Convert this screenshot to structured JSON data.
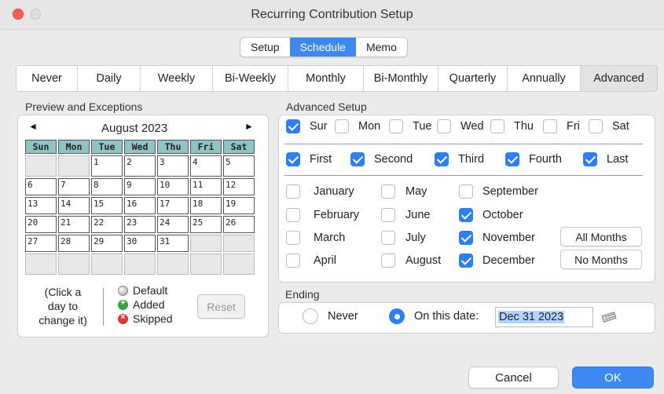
{
  "window": {
    "title": "Recurring Contribution Setup"
  },
  "top_tabs": [
    {
      "label": "Setup",
      "active": false
    },
    {
      "label": "Schedule",
      "active": true
    },
    {
      "label": "Memo",
      "active": false
    }
  ],
  "recurrence_tabs": [
    "Never",
    "Daily",
    "Weekly",
    "Bi-Weekly",
    "Monthly",
    "Bi-Monthly",
    "Quarterly",
    "Annually",
    "Advanced"
  ],
  "recurrence_selected": "Advanced",
  "preview": {
    "section_label": "Preview and Exceptions",
    "prev_icon": "◄",
    "next_icon": "►",
    "month": "August 2023",
    "weekdays": [
      "Sun",
      "Mon",
      "Tue",
      "Wed",
      "Thu",
      "Fri",
      "Sat"
    ],
    "weeks": [
      [
        "",
        "",
        "1",
        "2",
        "3",
        "4",
        "5"
      ],
      [
        "6",
        "7",
        "8",
        "9",
        "10",
        "11",
        "12"
      ],
      [
        "13",
        "14",
        "15",
        "16",
        "17",
        "18",
        "19"
      ],
      [
        "20",
        "21",
        "22",
        "23",
        "24",
        "25",
        "26"
      ],
      [
        "27",
        "28",
        "29",
        "30",
        "31",
        "",
        ""
      ],
      [
        "",
        "",
        "",
        "",
        "",
        "",
        ""
      ]
    ],
    "hint_lines": [
      "(Click a",
      "day to",
      "change it)"
    ],
    "legend": {
      "default": "Default",
      "added": "Added",
      "skipped": "Skipped"
    },
    "reset_label": "Reset"
  },
  "advanced": {
    "section_label": "Advanced Setup",
    "days": [
      {
        "label": "Sur",
        "checked": true
      },
      {
        "label": "Mon",
        "checked": false
      },
      {
        "label": "Tue",
        "checked": false
      },
      {
        "label": "Wed",
        "checked": false
      },
      {
        "label": "Thu",
        "checked": false
      },
      {
        "label": "Fri",
        "checked": false
      },
      {
        "label": "Sat",
        "checked": false
      }
    ],
    "occurrences": [
      {
        "label": "First",
        "checked": true
      },
      {
        "label": "Second",
        "checked": true
      },
      {
        "label": "Third",
        "checked": true
      },
      {
        "label": "Fourth",
        "checked": true
      },
      {
        "label": "Last",
        "checked": true
      }
    ],
    "months": [
      {
        "label": "January",
        "checked": false
      },
      {
        "label": "February",
        "checked": false
      },
      {
        "label": "March",
        "checked": false
      },
      {
        "label": "April",
        "checked": false
      },
      {
        "label": "May",
        "checked": false
      },
      {
        "label": "June",
        "checked": false
      },
      {
        "label": "July",
        "checked": false
      },
      {
        "label": "August",
        "checked": false
      },
      {
        "label": "September",
        "checked": false
      },
      {
        "label": "October",
        "checked": true
      },
      {
        "label": "November",
        "checked": true
      },
      {
        "label": "December",
        "checked": true
      }
    ],
    "all_months_label": "All Months",
    "no_months_label": "No Months"
  },
  "ending": {
    "section_label": "Ending",
    "never_label": "Never",
    "never_selected": false,
    "date_label": "On this date:",
    "date_selected": true,
    "date_value": "Dec 31 2023",
    "calendar_icon": "calendar-picker-icon"
  },
  "buttons": {
    "cancel": "Cancel",
    "ok": "OK"
  },
  "colors": {
    "accent": "#2d7ff0",
    "header_cell": "#8fc4c4",
    "close": "#fe5f57"
  }
}
